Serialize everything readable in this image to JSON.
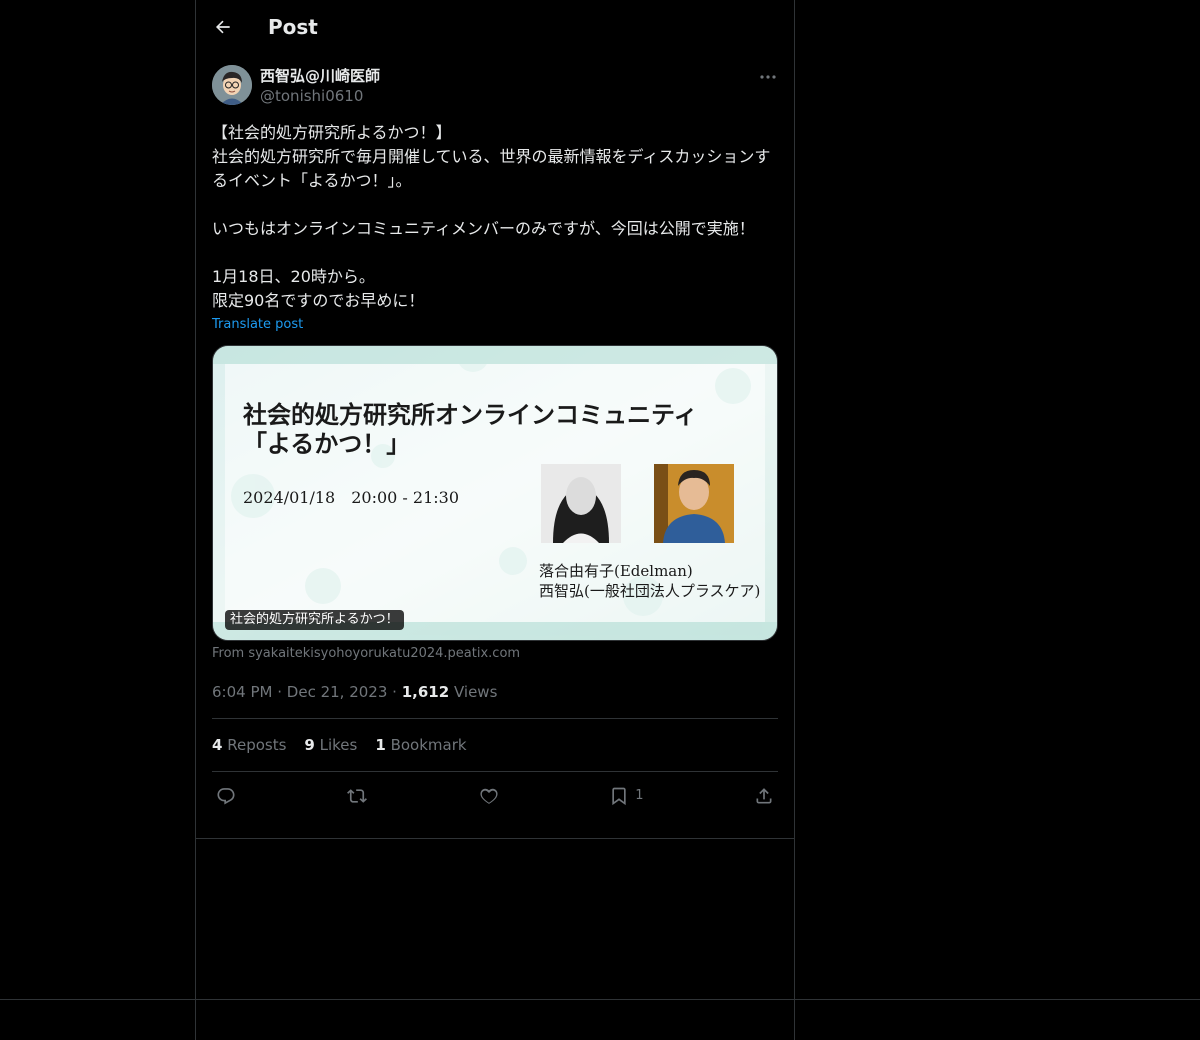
{
  "header": {
    "title": "Post"
  },
  "author": {
    "display_name": "西智弘@川崎医師",
    "handle": "@tonishi0610"
  },
  "post": {
    "text": "【社会的処方研究所よるかつ！】\n社会的処方研究所で毎月開催している、世界の最新情報をディスカッションするイベント「よるかつ！」。\n\nいつもはオンラインコミュニティメンバーのみですが、今回は公開で実施！\n\n1月18日、20時から。\n限定90名ですのでお早めに！",
    "translate_label": "Translate post"
  },
  "card": {
    "title_line1": "社会的処方研究所オンラインコミュニティ",
    "title_line2": "「よるかつ！」",
    "datetime": "2024/01/18　20:00 - 21:30",
    "speaker1": "落合由有子(Edelman)",
    "speaker2": "西智弘(一般社団法人プラスケア)",
    "label": "社会的処方研究所よるかつ！",
    "source": "From syakaitekisyohoyorukatu2024.peatix.com"
  },
  "meta": {
    "time": "6:04 PM",
    "date": "Dec 21, 2023",
    "views_count": "1,612",
    "views_label": "Views",
    "sep": "·"
  },
  "stats": {
    "reposts_count": "4",
    "reposts_label": "Reposts",
    "likes_count": "9",
    "likes_label": "Likes",
    "bookmarks_count": "1",
    "bookmarks_label": "Bookmark"
  },
  "actions": {
    "bookmark_count": "1"
  },
  "icons": [
    "back-arrow-icon",
    "more-icon",
    "reply-icon",
    "repost-icon",
    "like-icon",
    "bookmark-icon",
    "share-icon"
  ],
  "colors": {
    "background": "#000000",
    "text": "#e7e9ea",
    "muted": "#71767b",
    "accent": "#1d9bf0",
    "border": "#2f3336"
  }
}
